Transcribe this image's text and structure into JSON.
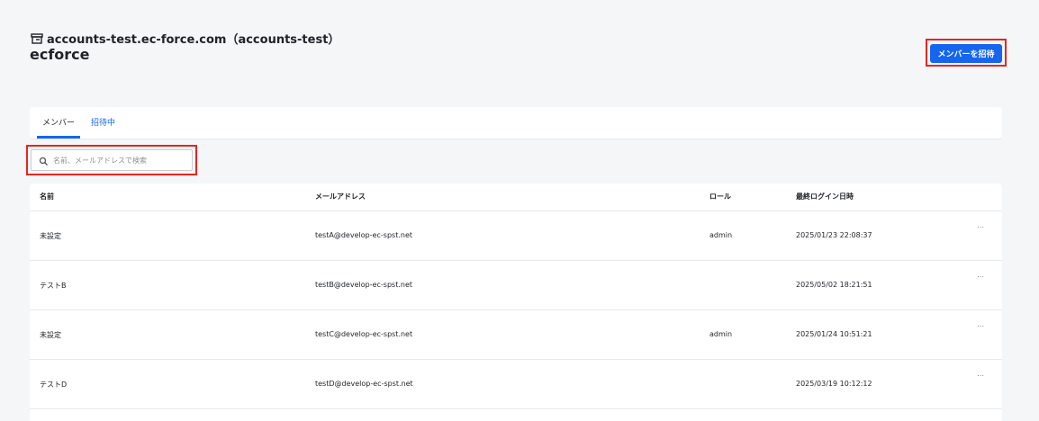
{
  "header": {
    "shop_label": "accounts-test.ec-force.com（accounts-test）",
    "org_name": "ecforce",
    "invite_button": "メンバーを招待"
  },
  "tabs": [
    {
      "label": "メンバー",
      "active": true
    },
    {
      "label": "招待中",
      "active": false
    }
  ],
  "search": {
    "placeholder": "名前、メールアドレスで検索",
    "value": ""
  },
  "table": {
    "columns": [
      "名前",
      "メールアドレス",
      "ロール",
      "最終ログイン日時"
    ],
    "rows": [
      {
        "name": "未設定",
        "email": "testA@develop-ec-spst.net",
        "role": "admin",
        "last_login": "2025/01/23 22:08:37",
        "menu": "···"
      },
      {
        "name": "テストB",
        "email": "testB@develop-ec-spst.net",
        "role": "",
        "last_login": "2025/05/02 18:21:51",
        "menu": "···"
      },
      {
        "name": "未設定",
        "email": "testC@develop-ec-spst.net",
        "role": "admin",
        "last_login": "2025/01/24 10:51:21",
        "menu": "···"
      },
      {
        "name": "テストD",
        "email": "testD@develop-ec-spst.net",
        "role": "",
        "last_login": "2025/03/19 10:12:12",
        "menu": "···"
      }
    ]
  },
  "colors": {
    "accent": "#1565f0",
    "highlight": "#e8251f",
    "background": "#f4f6f7"
  }
}
